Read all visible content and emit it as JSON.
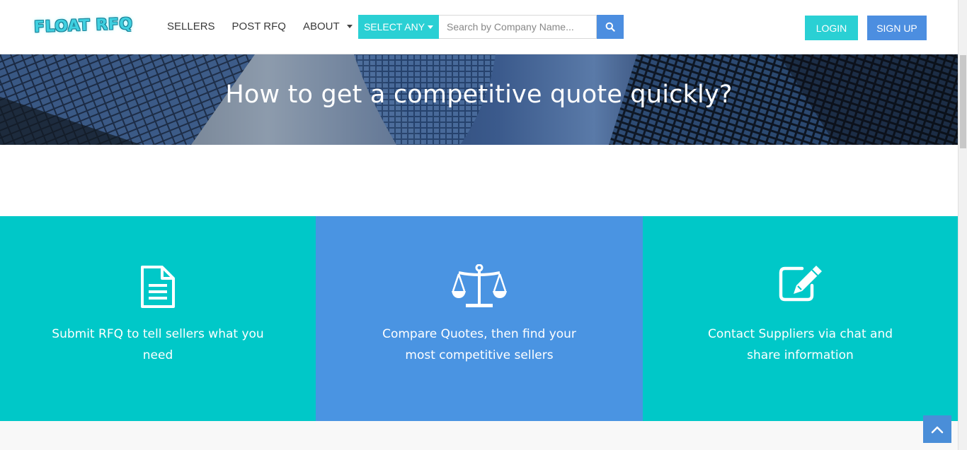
{
  "header": {
    "logo_text": "FLOAT RFQ",
    "nav": [
      "SELLERS",
      "POST RFQ",
      "ABOUT"
    ],
    "select_label": "SELECT ANY",
    "search_placeholder": "Search by Company Name...",
    "login_label": "LOGIN",
    "signup_label": "SIGN UP"
  },
  "hero": {
    "title": "How to get a competitive quote quickly?"
  },
  "features": [
    {
      "icon": "document-icon",
      "text": "Submit RFQ to tell sellers what you need"
    },
    {
      "icon": "balance-scale-icon",
      "text": "Compare Quotes, then find your most competitive sellers"
    },
    {
      "icon": "edit-icon",
      "text": "Contact Suppliers via chat and share information"
    }
  ],
  "colors": {
    "accent_teal": "#00c8c8",
    "accent_blue": "#4a94e2",
    "button_teal": "#2ad0d4",
    "button_blue": "#4c8ee0"
  }
}
